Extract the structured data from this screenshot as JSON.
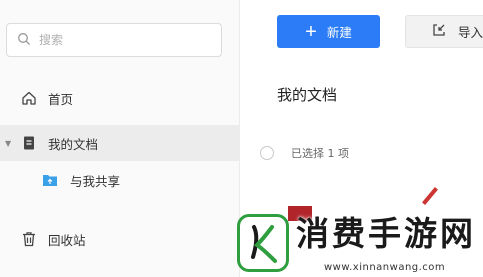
{
  "sidebar": {
    "search_placeholder": "搜索",
    "items": [
      {
        "label": "首页",
        "icon": "home-icon"
      },
      {
        "label": "我的文档",
        "icon": "document-icon",
        "expanded": true,
        "selected": true
      },
      {
        "label": "与我共享",
        "icon": "shared-folder-icon"
      },
      {
        "label": "回收站",
        "icon": "trash-icon"
      }
    ]
  },
  "toolbar": {
    "new_label": "新建",
    "import_label": "导入"
  },
  "main": {
    "title": "我的文档",
    "selection_text": "已选择 1 项"
  },
  "watermark": {
    "title": "消费手游网",
    "url": "www.xinnanwang.com"
  },
  "colors": {
    "primary": "#2b7cf6",
    "sidebar_bg": "#fafafa",
    "selected_bg": "#ececec",
    "logo_green": "#2f9e3f"
  }
}
